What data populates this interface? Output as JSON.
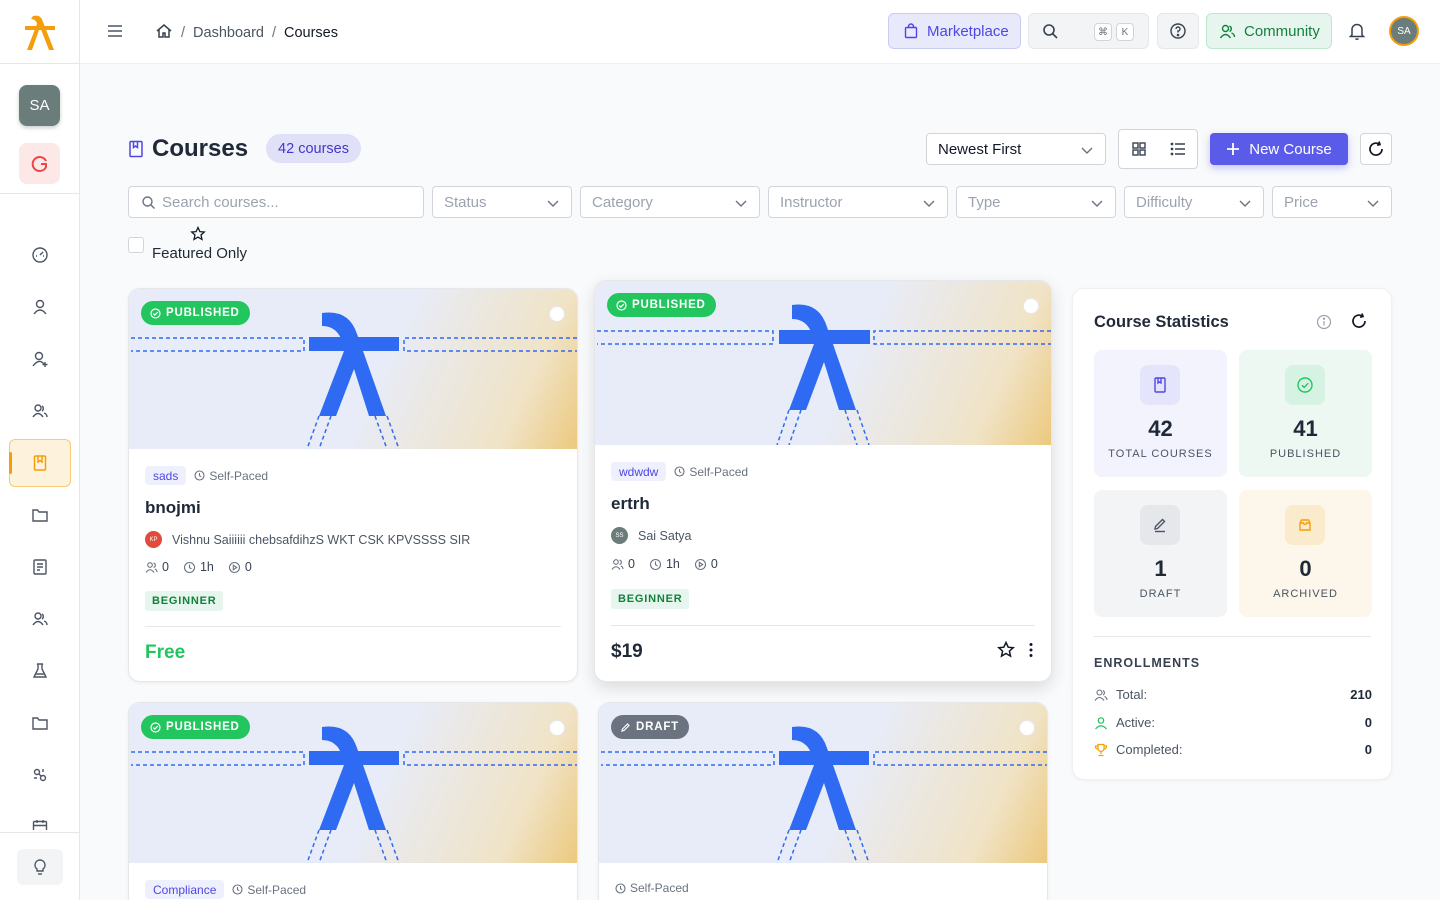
{
  "sidebar": {
    "user_initials": "SA",
    "org_initial": "G",
    "nav_icons": [
      "dashboard-icon",
      "user-icon",
      "user-plus-icon",
      "users-icon",
      "book-icon",
      "folder-icon",
      "report-icon",
      "groups-icon",
      "flask-icon",
      "folder-icon",
      "settings-icon",
      "calendar-icon"
    ],
    "active_index": 4
  },
  "topbar": {
    "breadcrumb": [
      "Dashboard",
      "Courses"
    ],
    "marketplace_label": "Marketplace",
    "kbd_cmd": "⌘",
    "kbd_key": "K",
    "community_label": "Community",
    "avatar_initials": "SA"
  },
  "page": {
    "title": "Courses",
    "count_label": "42 courses",
    "sort_value": "Newest First",
    "new_course_label": "New Course"
  },
  "filters": {
    "search_placeholder": "Search courses...",
    "status": "Status",
    "category": "Category",
    "instructor": "Instructor",
    "type": "Type",
    "difficulty": "Difficulty",
    "price": "Price",
    "featured_label": "Featured Only"
  },
  "courses": [
    {
      "status": "PUBLISHED",
      "tag": "sads",
      "pace": "Self-Paced",
      "title": "bnojmi",
      "instructor": "Vishnu Saiiiiii chebsafdihzS WKT CSK KPVSSSS SIR",
      "instructor_initials": "KP",
      "learners": "0",
      "duration": "1h",
      "lessons": "0",
      "level": "BEGINNER",
      "price": "Free"
    },
    {
      "status": "PUBLISHED",
      "tag": "wdwdw",
      "pace": "Self-Paced",
      "title": "ertrh",
      "instructor": "Sai Satya",
      "instructor_initials": "SS",
      "learners": "0",
      "duration": "1h",
      "lessons": "0",
      "level": "BEGINNER",
      "price": "$19"
    },
    {
      "status": "PUBLISHED",
      "tag": "Compliance",
      "pace": "Self-Paced"
    },
    {
      "status": "DRAFT",
      "pace": "Self-Paced"
    }
  ],
  "stats": {
    "title": "Course Statistics",
    "total": "42",
    "total_label": "TOTAL COURSES",
    "published": "41",
    "published_label": "PUBLISHED",
    "draft": "1",
    "draft_label": "DRAFT",
    "archived": "0",
    "archived_label": "ARCHIVED",
    "enrollments_title": "ENROLLMENTS",
    "total_enr_label": "Total:",
    "total_enr": "210",
    "active_label": "Active:",
    "active": "0",
    "completed_label": "Completed:",
    "completed": "0"
  },
  "colors": {
    "accent": "#5b5bea",
    "brand": "#f59e0b",
    "published": "#22c55e",
    "draft": "#6b7280",
    "logo_blue": "#2f6bf2"
  }
}
